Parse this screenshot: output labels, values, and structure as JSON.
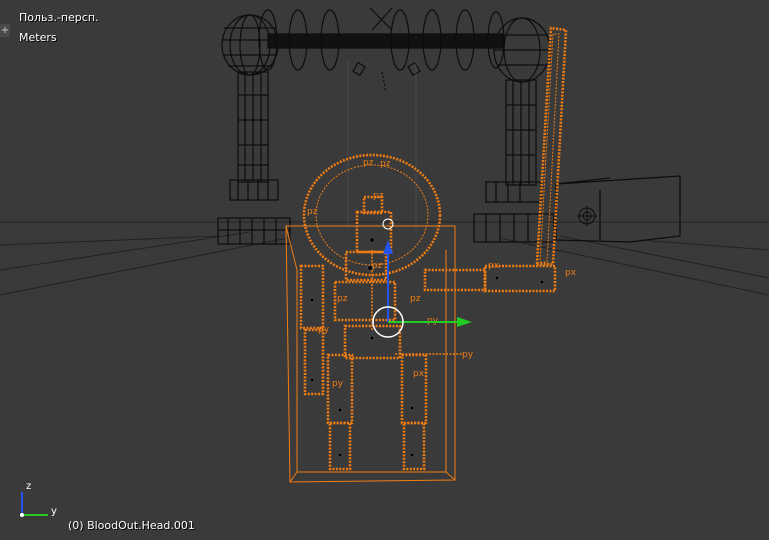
{
  "viewport": {
    "view_name": "Польз.-персп.",
    "units": "Meters",
    "status": "(0) BloodOut.Head.001",
    "expand_glyph": "+"
  },
  "axis_gizmo": {
    "z_label": "z",
    "y_label": "y"
  },
  "bone_labels": {
    "pz_top_a": "pz",
    "pz_top_b": "pz",
    "pz_head": "pz",
    "pz_neck": "pz",
    "pz_chest_l": "pz",
    "pz_chest_r": "pz",
    "pz_left": "pz",
    "py_left": "py",
    "py_right": "py",
    "py_hip": "py",
    "py_pelvis": "py",
    "px_arm": "px",
    "px_hand": "px",
    "px_leg": "px"
  },
  "colors": {
    "background": "#3a3a3a",
    "selection": "#f07d14",
    "wire": "#000000",
    "axis_y": "#22cc22",
    "axis_z": "#2255ee",
    "cursor": "#ffffff"
  }
}
